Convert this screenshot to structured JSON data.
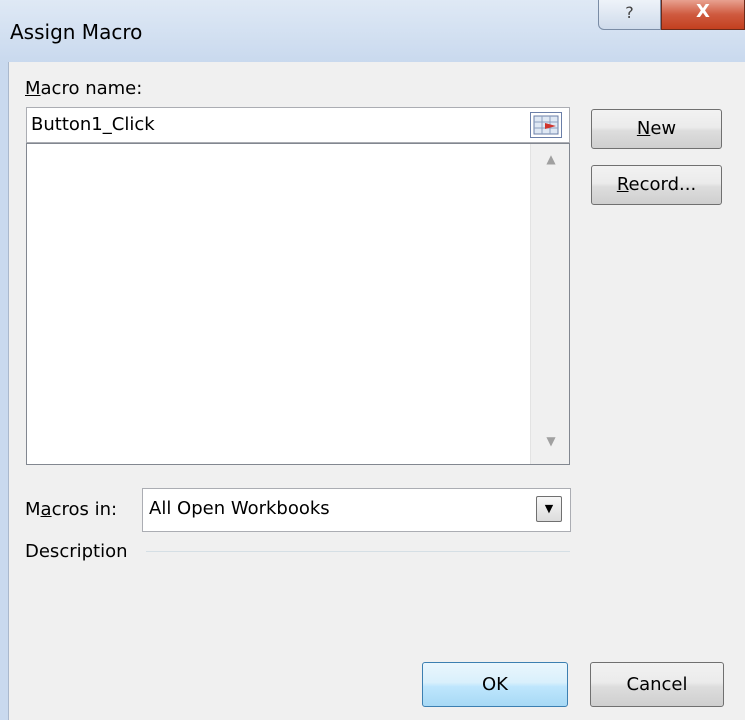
{
  "window": {
    "title": "Assign Macro",
    "help_glyph": "?",
    "close_glyph": "X"
  },
  "macro_name": {
    "label_accel": "M",
    "label_rest": "acro name:",
    "value": "Button1_Click",
    "ref_icon": "reference-picker-icon"
  },
  "macro_list": {
    "items": []
  },
  "buttons": {
    "new_accel": "N",
    "new_rest": "ew",
    "record_accel": "R",
    "record_rest": "ecord...",
    "ok": "OK",
    "cancel": "Cancel"
  },
  "macros_in": {
    "label_pre": "M",
    "label_accel": "a",
    "label_rest": "cros in:",
    "selected": "All Open Workbooks"
  },
  "description": {
    "label": "Description"
  },
  "colors": {
    "titlebar": "#c9d9ee",
    "close_button": "#c3401f",
    "dialog_bg": "#f0f0f0",
    "ok_border": "#3c7fb1"
  }
}
